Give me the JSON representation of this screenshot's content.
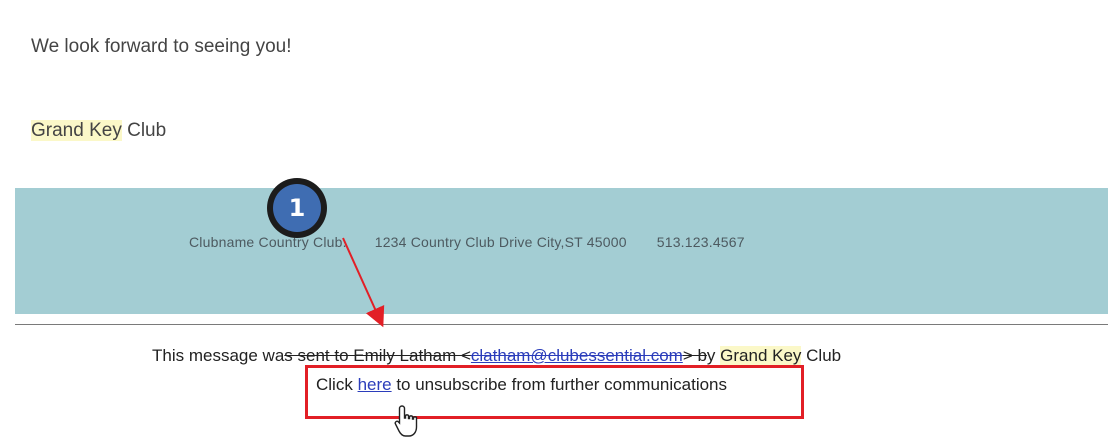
{
  "email": {
    "greeting": "We look forward to seeing you!",
    "signature": {
      "highlight": "Grand Key",
      "rest": " Club"
    }
  },
  "banner": {
    "club_name": "Clubname Country Club.",
    "address": "1234 Country Club Drive City,ST 45000",
    "phone": "513.123.4567"
  },
  "footer": {
    "sent_prefix": "This message wa",
    "sent_struck": "s sent to Emily Latham <",
    "sent_email": "clatham@clubessential.com",
    "sent_struck_end": "> b",
    "sent_after": "y ",
    "sent_club": "Grand Key",
    "sent_club_rest": " Club",
    "unsubscribe_prefix": "Click ",
    "unsubscribe_link": "here",
    "unsubscribe_suffix": " to unsubscribe from further communications"
  },
  "annotation": {
    "step_number": "1",
    "highlight_color": "#e21f26",
    "badge_color": "#3f6db2",
    "cursor_icon": "hand-pointer-icon"
  },
  "colors": {
    "banner_bg": "#a3cdd3",
    "link": "#2b3dbb",
    "text_highlight": "#fbf8c8"
  }
}
